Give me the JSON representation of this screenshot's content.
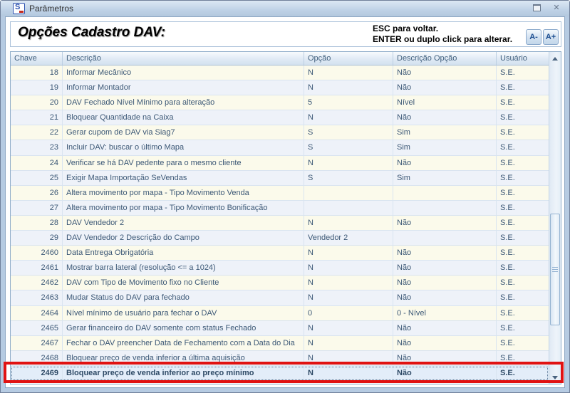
{
  "window": {
    "title": "Parâmetros"
  },
  "icons": {
    "close": "✕"
  },
  "header": {
    "title": "Opções Cadastro DAV:",
    "hint_line1": "ESC para voltar.",
    "hint_line2": "ENTER ou duplo click para alterar.",
    "font_decrease_label": "A-",
    "font_increase_label": "A+"
  },
  "table": {
    "columns": [
      "Chave",
      "Descrição",
      "Opção",
      "Descrição Opção",
      "Usuário"
    ],
    "rows": [
      {
        "key": "18",
        "description": "Informar Mecânico",
        "option": "N",
        "option_description": "Não",
        "user": "S.E."
      },
      {
        "key": "19",
        "description": "Informar Montador",
        "option": "N",
        "option_description": "Não",
        "user": "S.E."
      },
      {
        "key": "20",
        "description": "DAV Fechado Nível Mínimo para alteração",
        "option": "5",
        "option_description": "Nível",
        "user": "S.E."
      },
      {
        "key": "21",
        "description": "Bloquear Quantidade na Caixa",
        "option": "N",
        "option_description": "Não",
        "user": "S.E."
      },
      {
        "key": "22",
        "description": "Gerar cupom de DAV via Siag7",
        "option": "S",
        "option_description": "Sim",
        "user": "S.E."
      },
      {
        "key": "23",
        "description": "Incluir DAV: buscar o último Mapa",
        "option": "S",
        "option_description": "Sim",
        "user": "S.E."
      },
      {
        "key": "24",
        "description": "Verificar se há DAV pedente para o mesmo cliente",
        "option": "N",
        "option_description": "Não",
        "user": "S.E."
      },
      {
        "key": "25",
        "description": "Exigir Mapa Importação SeVendas",
        "option": "S",
        "option_description": "Sim",
        "user": "S.E."
      },
      {
        "key": "26",
        "description": "Altera movimento por mapa - Tipo Movimento Venda",
        "option": "",
        "option_description": "",
        "user": "S.E."
      },
      {
        "key": "27",
        "description": "Altera movimento por mapa - Tipo Movimento Bonificação",
        "option": "",
        "option_description": "",
        "user": "S.E."
      },
      {
        "key": "28",
        "description": "DAV Vendedor 2",
        "option": "N",
        "option_description": "Não",
        "user": "S.E."
      },
      {
        "key": "29",
        "description": "DAV Vendedor 2 Descrição do Campo",
        "option": "Vendedor 2",
        "option_description": "",
        "user": "S.E."
      },
      {
        "key": "2460",
        "description": "Data Entrega Obrigatória",
        "option": "N",
        "option_description": "Não",
        "user": "S.E."
      },
      {
        "key": "2461",
        "description": "Mostrar barra lateral (resolução <= a 1024)",
        "option": "N",
        "option_description": "Não",
        "user": "S.E."
      },
      {
        "key": "2462",
        "description": "DAV com Tipo de Movimento fixo no Cliente",
        "option": "N",
        "option_description": "Não",
        "user": "S.E."
      },
      {
        "key": "2463",
        "description": "Mudar Status do DAV para fechado",
        "option": "N",
        "option_description": "Não",
        "user": "S.E."
      },
      {
        "key": "2464",
        "description": "Nível mínimo de usuário para fechar o DAV",
        "option": "0",
        "option_description": "0 - Nível",
        "user": "S.E."
      },
      {
        "key": "2465",
        "description": "Gerar financeiro do DAV somente com status Fechado",
        "option": "N",
        "option_description": "Não",
        "user": "S.E."
      },
      {
        "key": "2467",
        "description": "Fechar o DAV preencher Data de Fechamento com a Data do Dia",
        "option": "N",
        "option_description": "Não",
        "user": "S.E."
      },
      {
        "key": "2468",
        "description": "Bloquear preço de venda inferior a última aquisição",
        "option": "N",
        "option_description": "Não",
        "user": "S.E."
      },
      {
        "key": "2469",
        "description": "Bloquear preço de venda inferior ao preço mínimo",
        "option": "N",
        "option_description": "Não",
        "user": "S.E.",
        "selected": true
      }
    ]
  },
  "colors": {
    "selection_highlight": "#e01212",
    "row_even": "#fbfaeb",
    "row_odd": "#eef2f9",
    "selected_row_bg": "#e3edf9",
    "titlebar": "#bfd2e6"
  }
}
